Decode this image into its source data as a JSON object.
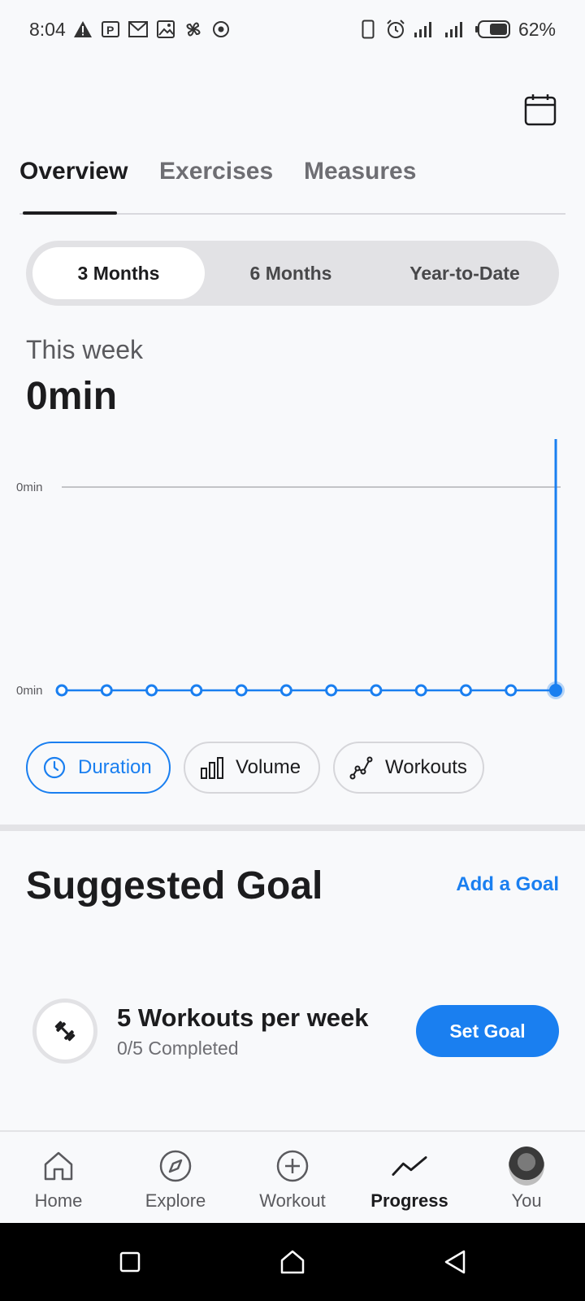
{
  "status_bar": {
    "time": "8:04",
    "battery": "62%",
    "left_icons": [
      "warning-icon",
      "parking-icon",
      "gmail-icon",
      "image-icon",
      "pinwheel-icon",
      "target-icon"
    ],
    "right_icons": [
      "phone-outline-icon",
      "alarm-icon",
      "signal-icon",
      "signal-icon",
      "battery-icon"
    ]
  },
  "calendar_icon": "calendar-icon",
  "tabs": [
    {
      "label": "Overview",
      "active": true
    },
    {
      "label": "Exercises",
      "active": false
    },
    {
      "label": "Measures",
      "active": false
    }
  ],
  "range": {
    "options": [
      "3 Months",
      "6 Months",
      "Year-to-Date"
    ],
    "selected": "3 Months"
  },
  "summary": {
    "label": "This week",
    "value": "0min"
  },
  "chart_data": {
    "type": "line",
    "y_tick_labels": [
      "0min",
      "0min"
    ],
    "values": [
      0,
      0,
      0,
      0,
      0,
      0,
      0,
      0,
      0,
      0,
      0,
      0
    ],
    "selected_index": 11,
    "color": "#1a7ff0"
  },
  "metrics": [
    {
      "label": "Duration",
      "icon": "clock-icon",
      "active": true
    },
    {
      "label": "Volume",
      "icon": "bar-chart-icon",
      "active": false
    },
    {
      "label": "Workouts",
      "icon": "scatter-line-icon",
      "active": false
    }
  ],
  "goals": {
    "title": "Suggested Goal",
    "add_label": "Add a Goal",
    "item": {
      "name": "5 Workouts per week",
      "progress": "0/5 Completed",
      "icon": "dumbbell-icon",
      "button": "Set Goal"
    }
  },
  "bottom_nav": [
    {
      "label": "Home",
      "icon": "home-icon",
      "active": false
    },
    {
      "label": "Explore",
      "icon": "compass-icon",
      "active": false
    },
    {
      "label": "Workout",
      "icon": "plus-circle-icon",
      "active": false
    },
    {
      "label": "Progress",
      "icon": "trend-icon",
      "active": true
    },
    {
      "label": "You",
      "icon": "avatar",
      "active": false
    }
  ],
  "system_nav": [
    "recents-icon",
    "home-button-icon",
    "back-icon"
  ]
}
